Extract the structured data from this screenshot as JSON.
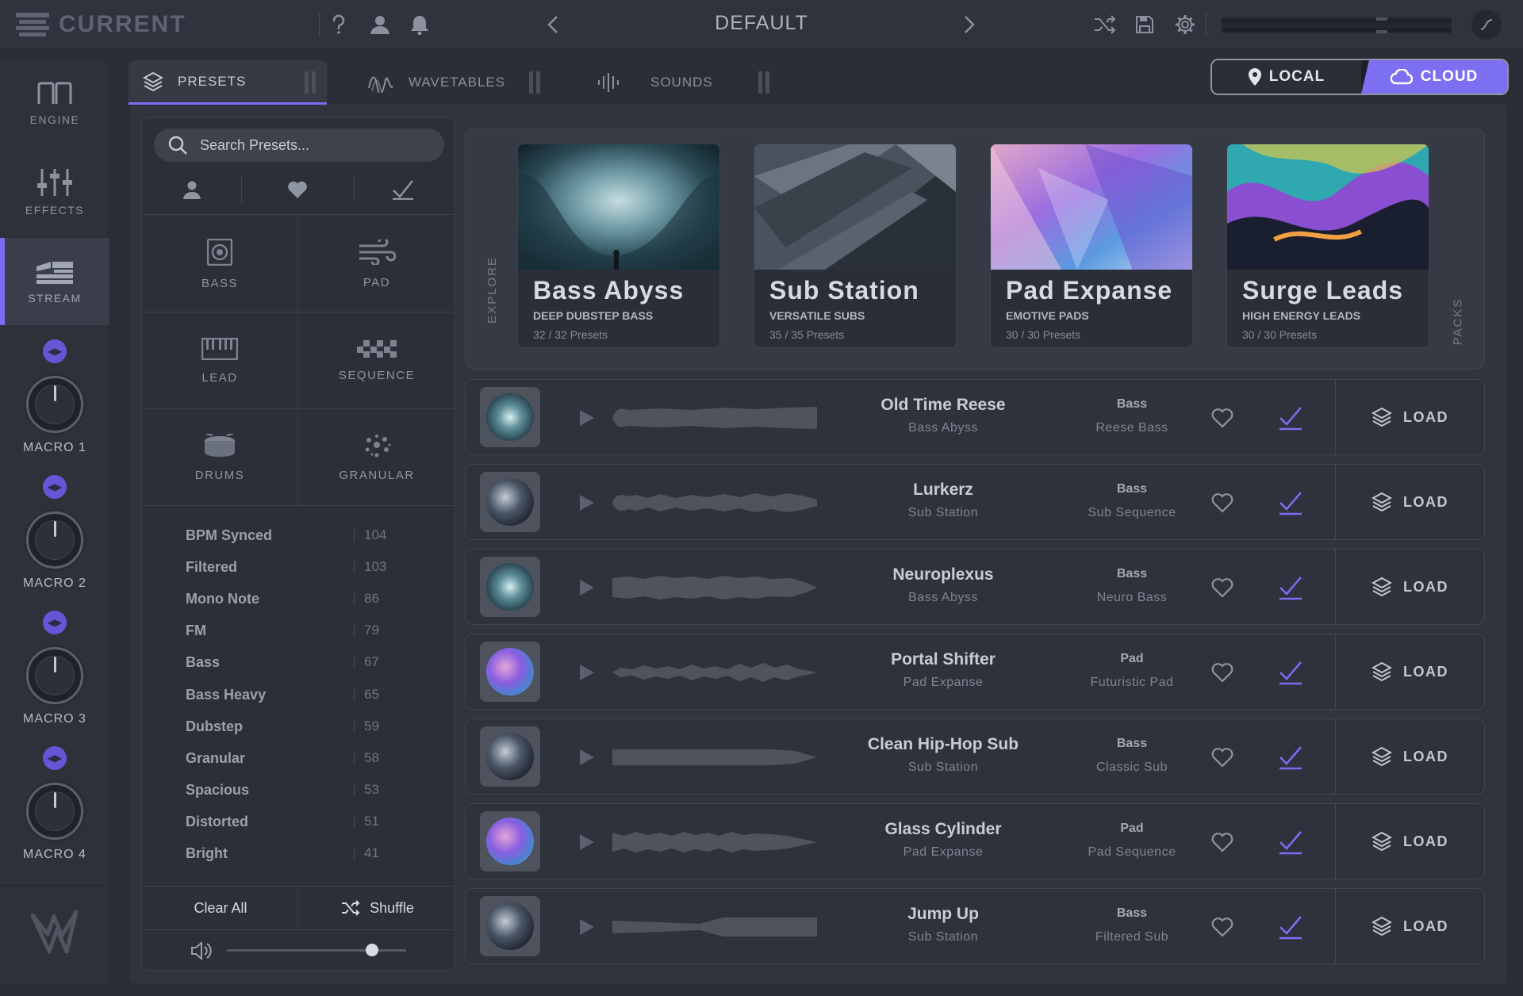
{
  "app": {
    "name": "CURRENT",
    "preset_name": "DEFAULT"
  },
  "sidebar": {
    "items": [
      {
        "label": "ENGINE",
        "icon": "engine-icon"
      },
      {
        "label": "EFFECTS",
        "icon": "effects-sliders-icon"
      },
      {
        "label": "STREAM",
        "icon": "stream-icon",
        "active": true
      }
    ],
    "macros": [
      "MACRO 1",
      "MACRO 2",
      "MACRO 3",
      "MACRO 4"
    ]
  },
  "tabs": [
    {
      "label": "PRESETS",
      "active": true
    },
    {
      "label": "WAVETABLES"
    },
    {
      "label": "SOUNDS"
    }
  ],
  "source_toggle": {
    "local": "LOCAL",
    "cloud": "CLOUD",
    "selected": "CLOUD"
  },
  "search": {
    "placeholder": "Search Presets..."
  },
  "categories": [
    "BASS",
    "PAD",
    "LEAD",
    "SEQUENCE",
    "DRUMS",
    "GRANULAR"
  ],
  "tags": [
    {
      "name": "BPM Synced",
      "count": "104"
    },
    {
      "name": "Filtered",
      "count": "103"
    },
    {
      "name": "Mono Note",
      "count": "86"
    },
    {
      "name": "FM",
      "count": "79"
    },
    {
      "name": "Bass",
      "count": "67"
    },
    {
      "name": "Bass Heavy",
      "count": "65"
    },
    {
      "name": "Dubstep",
      "count": "59"
    },
    {
      "name": "Granular",
      "count": "58"
    },
    {
      "name": "Spacious",
      "count": "53"
    },
    {
      "name": "Distorted",
      "count": "51"
    },
    {
      "name": "Bright",
      "count": "41"
    }
  ],
  "footer": {
    "clear_all": "Clear All",
    "shuffle": "Shuffle",
    "volume_fraction": 0.81
  },
  "explore": {
    "label": "EXPLORE",
    "packs_label": "PACKS",
    "packs": [
      {
        "title": "Bass Abyss",
        "subtitle": "DEEP DUBSTEP BASS",
        "count": "32 / 32 Presets"
      },
      {
        "title": "Sub Station",
        "subtitle": "VERSATILE SUBS",
        "count": "35 / 35 Presets"
      },
      {
        "title": "Pad Expanse",
        "subtitle": "EMOTIVE PADS",
        "count": "30 / 30 Presets"
      },
      {
        "title": "Surge Leads",
        "subtitle": "HIGH ENERGY LEADS",
        "count": "30 / 30 Presets"
      }
    ]
  },
  "presets": [
    {
      "name": "Old Time Reese",
      "pack": "Bass Abyss",
      "type": "Bass",
      "subtype": "Reese Bass",
      "load": "LOAD"
    },
    {
      "name": "Lurkerz",
      "pack": "Sub Station",
      "type": "Bass",
      "subtype": "Sub Sequence",
      "load": "LOAD"
    },
    {
      "name": "Neuroplexus",
      "pack": "Bass Abyss",
      "type": "Bass",
      "subtype": "Neuro Bass",
      "load": "LOAD"
    },
    {
      "name": "Portal Shifter",
      "pack": "Pad Expanse",
      "type": "Pad",
      "subtype": "Futuristic Pad",
      "load": "LOAD"
    },
    {
      "name": "Clean Hip-Hop Sub",
      "pack": "Sub Station",
      "type": "Bass",
      "subtype": "Classic Sub",
      "load": "LOAD"
    },
    {
      "name": "Glass Cylinder",
      "pack": "Pad Expanse",
      "type": "Pad",
      "subtype": "Pad Sequence",
      "load": "LOAD"
    },
    {
      "name": "Jump Up",
      "pack": "Sub Station",
      "type": "Bass",
      "subtype": "Filtered Sub",
      "load": "LOAD"
    }
  ],
  "colors": {
    "accent": "#7b6cf3",
    "background": "#2a2e37",
    "panel": "#30343e"
  }
}
